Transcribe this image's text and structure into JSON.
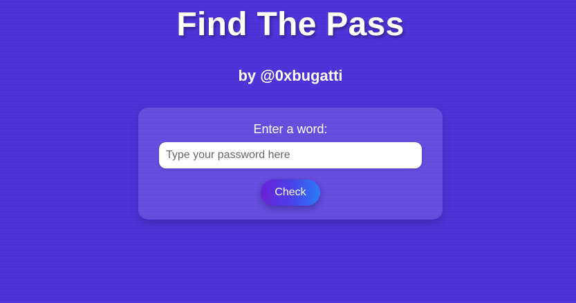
{
  "header": {
    "title": "Find The Pass",
    "subtitle": "by @0xbugatti"
  },
  "form": {
    "prompt": "Enter a word:",
    "input_value": "",
    "input_placeholder": "Type your password here",
    "check_label": "Check"
  },
  "colors": {
    "background": "#4d32d8",
    "card": "rgba(255,255,255,0.13)",
    "button_gradient_start": "#6a22d6",
    "button_gradient_end": "#2a7cf6",
    "text": "#ffffff"
  }
}
